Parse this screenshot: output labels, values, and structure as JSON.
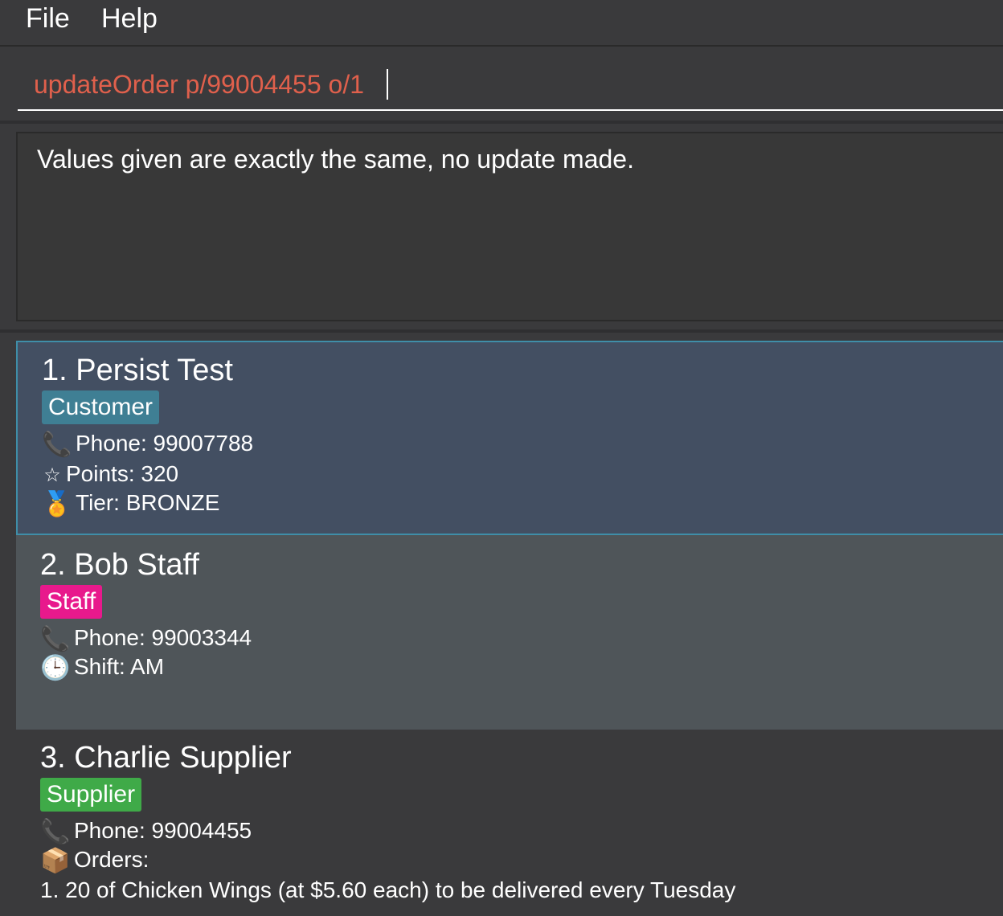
{
  "menu": {
    "file_label": "File",
    "help_label": "Help"
  },
  "command": {
    "value": "updateOrder p/99004455 o/1"
  },
  "result": {
    "message": "Values given are exactly the same, no update made."
  },
  "persons": [
    {
      "name": "1. Persist Test",
      "role": "Customer",
      "role_color": "#3f7f94",
      "phone": "Phone: 99007788",
      "points": "Points: 320",
      "tier": "Tier: BRONZE"
    },
    {
      "name": "2. Bob Staff",
      "role": "Staff",
      "role_color": "#e8198c",
      "phone": "Phone: 99003344",
      "shift": "Shift: AM"
    },
    {
      "name": "3. Charlie Supplier",
      "role": "Supplier",
      "role_color": "#3faa48",
      "phone": "Phone: 99004455",
      "orders_label": "Orders:",
      "orders": [
        "1. 20 of Chicken Wings (at $5.60 each) to be delivered every Tuesday"
      ]
    }
  ],
  "icons": {
    "phone": "phone-icon",
    "points": "star-icon",
    "tier": "medal-icon",
    "shift": "clock-icon",
    "orders": "package-icon"
  },
  "colors": {
    "command_text": "#e0604c",
    "selected_card": "#434f62",
    "selected_border": "#3f8ea8"
  }
}
